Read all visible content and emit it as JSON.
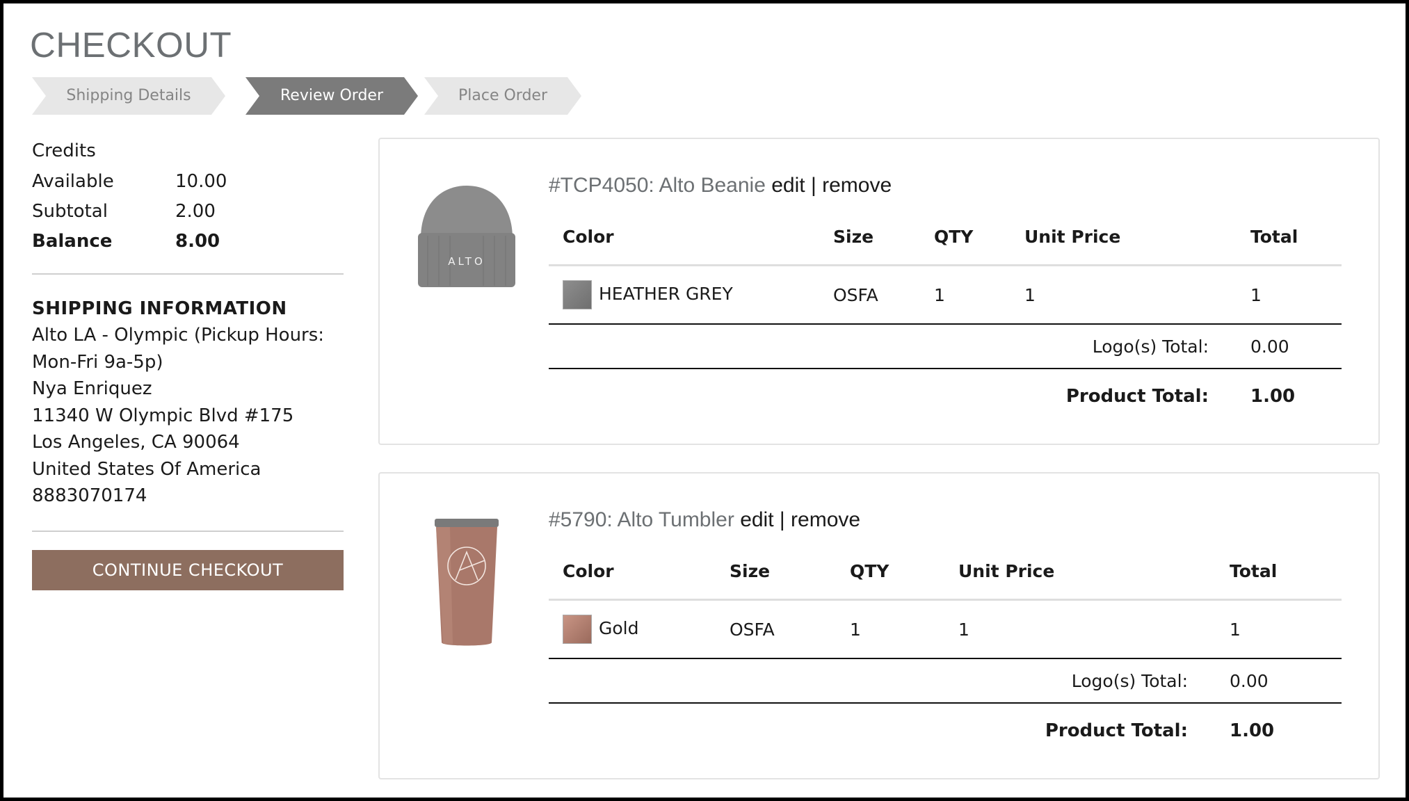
{
  "page": {
    "title": "CHECKOUT"
  },
  "steps": [
    {
      "label": "Shipping Details",
      "state": "inactive"
    },
    {
      "label": "Review Order",
      "state": "active"
    },
    {
      "label": "Place Order",
      "state": "inactive"
    }
  ],
  "credits": {
    "heading": "Credits",
    "available_label": "Available",
    "available_value": "10.00",
    "subtotal_label": "Subtotal",
    "subtotal_value": "2.00",
    "balance_label": "Balance",
    "balance_value": "8.00"
  },
  "shipping": {
    "heading": "SHIPPING INFORMATION",
    "lines": [
      "Alto LA - Olympic (Pickup Hours:",
      "Mon-Fri 9a-5p)",
      "Nya Enriquez",
      "11340 W Olympic Blvd #175",
      "Los Angeles, CA 90064",
      "United States Of America",
      "8883070174"
    ]
  },
  "continue_label": "CONTINUE CHECKOUT",
  "table_headers": {
    "color": "Color",
    "size": "Size",
    "qty": "QTY",
    "unit_price": "Unit Price",
    "total": "Total"
  },
  "products": [
    {
      "code_name": "#TCP4050: Alto Beanie",
      "edit_label": "edit",
      "separator": "|",
      "remove_label": "remove",
      "image_icon": "beanie-icon",
      "image_text": "ALTO",
      "color_name": "HEATHER GREY",
      "swatch_color": "#7f7f7f",
      "size": "OSFA",
      "qty": "1",
      "unit_price": "1",
      "total": "1",
      "logo_total_label": "Logo(s) Total:",
      "logo_total": "0.00",
      "product_total_label": "Product Total:",
      "product_total": "1.00"
    },
    {
      "code_name": "#5790: Alto Tumbler",
      "edit_label": "edit",
      "separator": "|",
      "remove_label": "remove",
      "image_icon": "tumbler-icon",
      "color_name": "Gold",
      "swatch_color": "#b5806f",
      "size": "OSFA",
      "qty": "1",
      "unit_price": "1",
      "total": "1",
      "logo_total_label": "Logo(s) Total:",
      "logo_total": "0.00",
      "product_total_label": "Product Total:",
      "product_total": "1.00"
    }
  ],
  "colors": {
    "accent_button": "#8d6e5f",
    "step_active": "#7b7b7b",
    "step_inactive": "#e7e7e7",
    "title_gray": "#6c7073"
  }
}
